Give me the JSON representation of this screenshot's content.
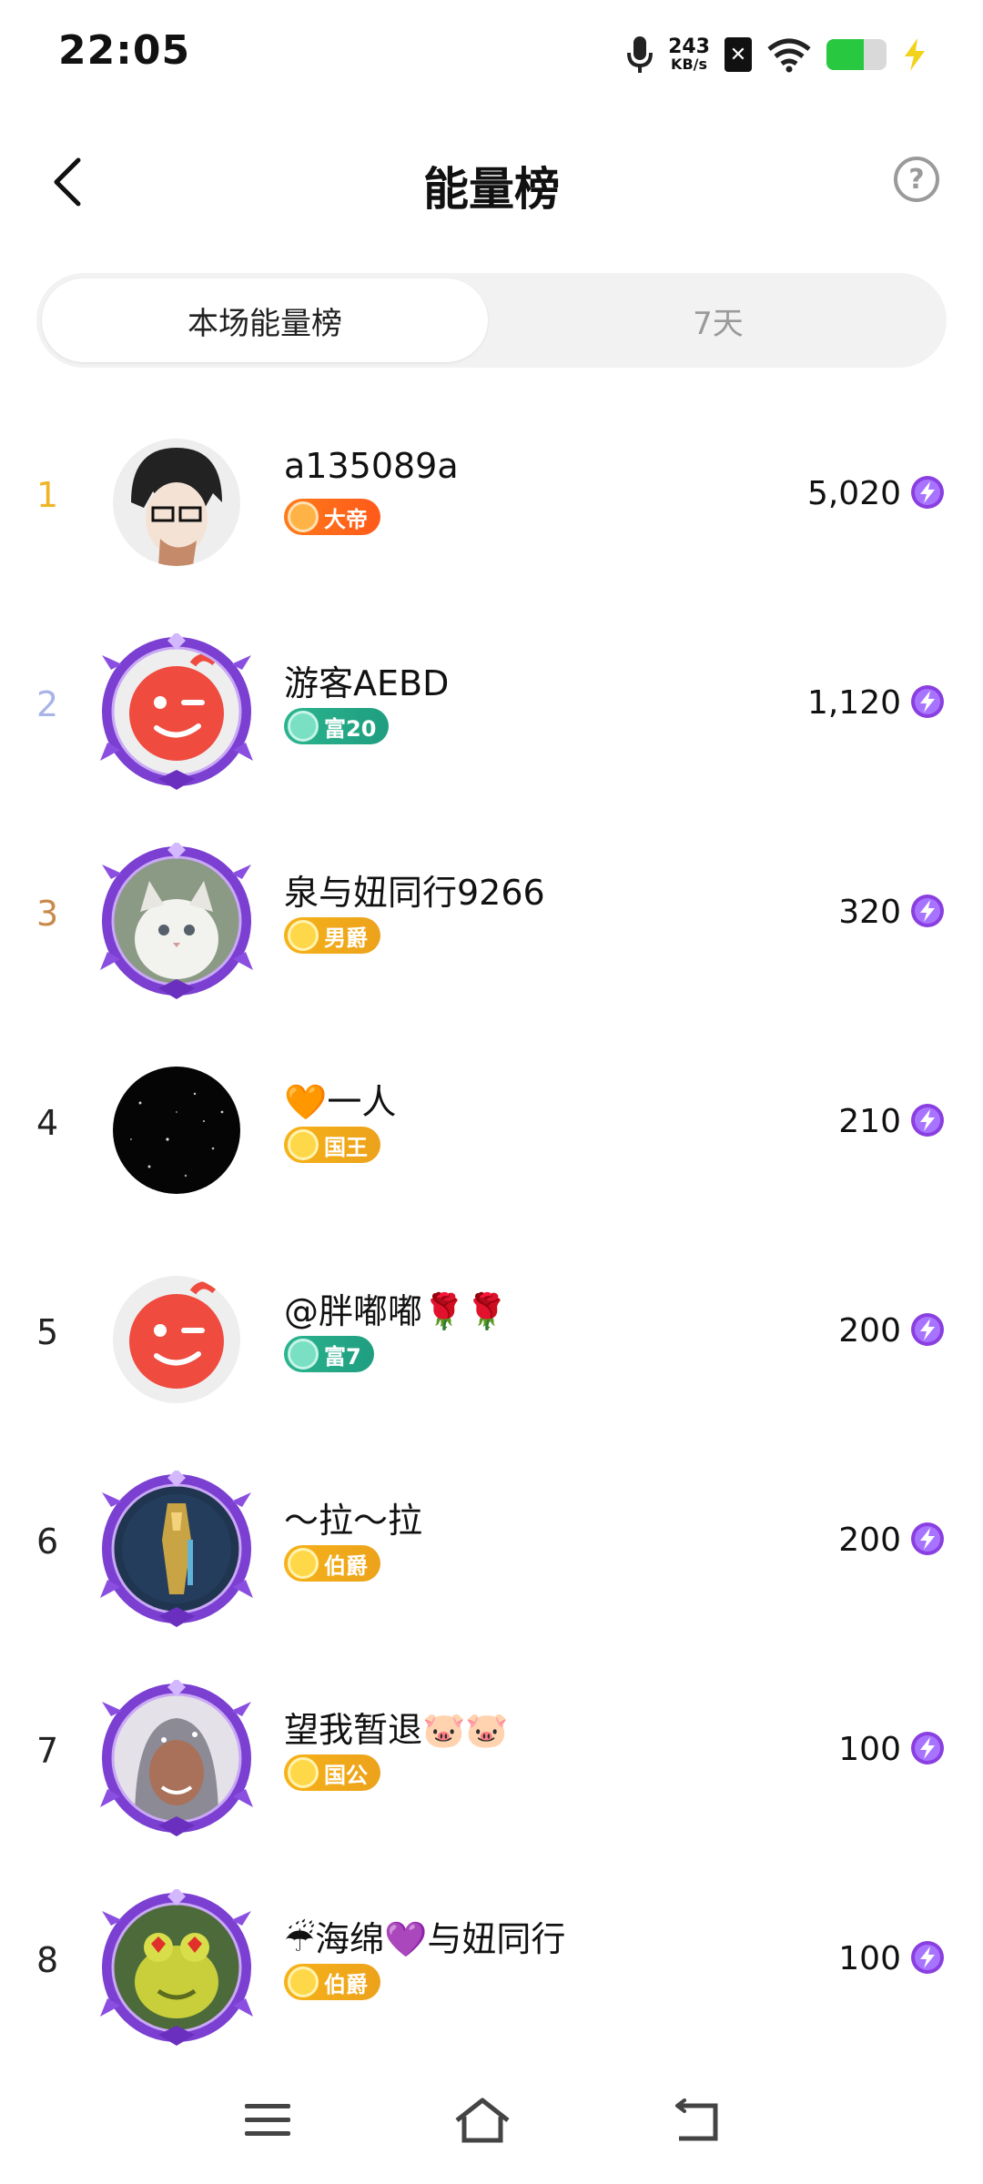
{
  "status_bar": {
    "time": "22:05",
    "net_speed_value": "243",
    "net_speed_unit": "KB/s",
    "sim_label": "✕",
    "battery_level": 0.62,
    "icons": [
      "microphone-icon",
      "sim-icon",
      "wifi-icon",
      "battery-icon",
      "charging-icon"
    ]
  },
  "header": {
    "title": "能量榜",
    "help_glyph": "?"
  },
  "tabs": [
    {
      "label": "本场能量榜",
      "active": true
    },
    {
      "label": "7天",
      "active": false
    }
  ],
  "colors": {
    "rank_1": "#f0b429",
    "rank_2": "#a8b4e6",
    "rank_3": "#c98a4a",
    "rank_default": "#222222",
    "energy_purple": "#8a3fe0",
    "frame_purple": "#7b3fd1"
  },
  "ranking": [
    {
      "rank": "1",
      "name": "a135089a",
      "badge": "大帝",
      "badge_style": "orange",
      "score": "5,020",
      "avatar": "anime-boy-glasses",
      "frame": false
    },
    {
      "rank": "2",
      "name": "游客AEBD",
      "badge": "富20",
      "badge_style": "teal",
      "score": "1,120",
      "avatar": "red-wink-face",
      "frame": true
    },
    {
      "rank": "3",
      "name": "泉与妞同行9266",
      "badge": "男爵",
      "badge_style": "gold",
      "score": "320",
      "avatar": "white-cat",
      "frame": true
    },
    {
      "rank": "4",
      "name": "🧡一人",
      "badge": "国王",
      "badge_style": "gold",
      "score": "210",
      "avatar": "night-sky",
      "frame": false
    },
    {
      "rank": "5",
      "name": "@胖嘟嘟🌹🌹",
      "badge": "富7",
      "badge_style": "teal",
      "score": "200",
      "avatar": "red-wink-face",
      "frame": false
    },
    {
      "rank": "6",
      "name": "～拉～拉",
      "badge": "伯爵",
      "badge_style": "gold",
      "score": "200",
      "avatar": "game-character",
      "frame": true
    },
    {
      "rank": "7",
      "name": "望我暂退🐷🐷",
      "badge": "国公",
      "badge_style": "gold",
      "score": "100",
      "avatar": "person-headscarf",
      "frame": true
    },
    {
      "rank": "8",
      "name": "☔海绵💜与妞同行",
      "badge": "伯爵",
      "badge_style": "gold",
      "score": "100",
      "avatar": "green-frog",
      "frame": true
    }
  ]
}
